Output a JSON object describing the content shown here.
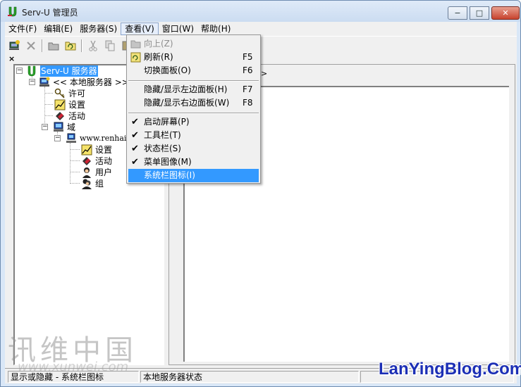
{
  "window": {
    "title": "Serv-U 管理员",
    "minimize": "−",
    "maximize": "□",
    "close": "✕"
  },
  "menubar": {
    "items": [
      "文件(F)",
      "编辑(E)",
      "服务器(S)",
      "查看(V)",
      "窗口(W)",
      "帮助(H)"
    ],
    "active_index": 3
  },
  "view_menu": {
    "items": [
      {
        "label": "向上(Z)",
        "shortcut": "",
        "state": "disabled",
        "icon": "up-folder-icon"
      },
      {
        "label": "刷新(R)",
        "shortcut": "F5",
        "state": "normal",
        "icon": "refresh-icon"
      },
      {
        "label": "切换面板(O)",
        "shortcut": "F6",
        "state": "normal"
      },
      {
        "label": "隐藏/显示左边面板(H)",
        "shortcut": "F7",
        "state": "normal"
      },
      {
        "label": "隐藏/显示右边面板(W)",
        "shortcut": "F8",
        "state": "normal"
      },
      {
        "label": "启动屏幕(P)",
        "shortcut": "",
        "state": "checked"
      },
      {
        "label": "工具栏(T)",
        "shortcut": "",
        "state": "checked"
      },
      {
        "label": "状态栏(S)",
        "shortcut": "",
        "state": "checked"
      },
      {
        "label": "菜单图像(M)",
        "shortcut": "",
        "state": "checked"
      },
      {
        "label": "系统栏图标(I)",
        "shortcut": "",
        "state": "highlighted"
      }
    ]
  },
  "tree": {
    "root": "Serv-U 服务器",
    "local_server": "<< 本地服务器 >>",
    "license": "许可",
    "settings": "设置",
    "activity": "活动",
    "domains": "域",
    "domain_name": "www.renhait",
    "domain_settings": "设置",
    "domain_activity": "活动",
    "users": "用户",
    "groups": "组"
  },
  "right_pane": {
    "fragment": ">"
  },
  "statusbar": {
    "left": "显示或隐藏 - 系统栏图标",
    "right": "本地服务器状态"
  },
  "watermarks": {
    "cn": "讯维中国",
    "cn_sub": "www.xunwei.com",
    "en": "LanYingBlog.Com"
  },
  "colors": {
    "highlight": "#3399ff",
    "title_gradient_top": "#dfeaf8",
    "close_button": "#c8432e",
    "watermark_blue": "#1c2fb5"
  }
}
